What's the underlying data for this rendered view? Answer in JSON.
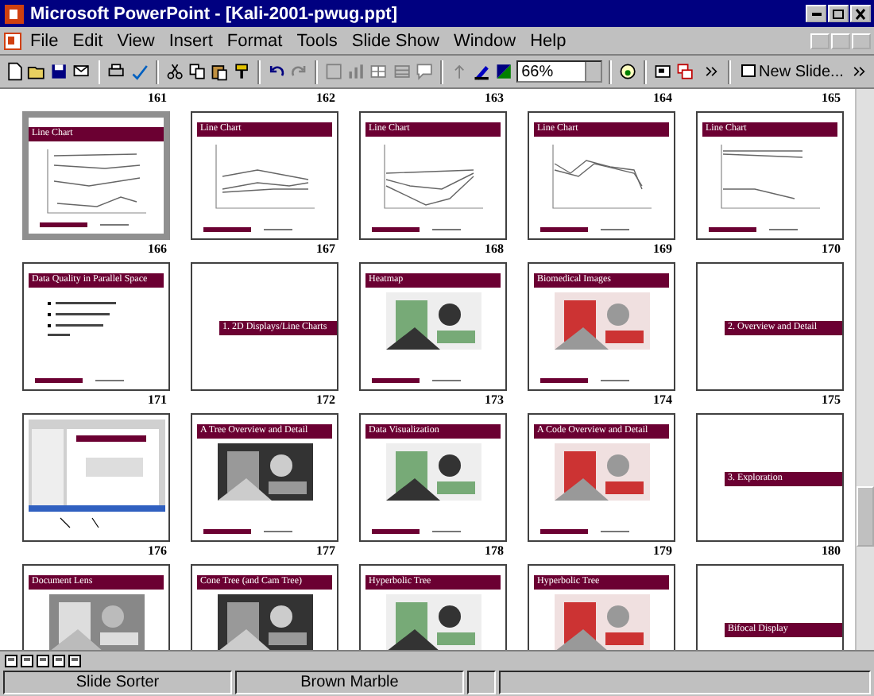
{
  "window": {
    "title": "Microsoft PowerPoint - [Kali-2001-pwug.ppt]"
  },
  "menu": [
    "File",
    "Edit",
    "View",
    "Insert",
    "Format",
    "Tools",
    "Slide Show",
    "Window",
    "Help"
  ],
  "toolbar": {
    "zoom": "66%",
    "new_slide": "New Slide..."
  },
  "numbers_above": [
    "161",
    "162",
    "163",
    "164",
    "165"
  ],
  "rows": [
    {
      "numbers": [
        "166",
        "167",
        "168",
        "169",
        "170"
      ],
      "slides": [
        {
          "title": "Line Chart",
          "kind": "chart",
          "selected": true
        },
        {
          "title": "Line Chart",
          "kind": "chart",
          "selected": false
        },
        {
          "title": "Line Chart",
          "kind": "chart",
          "selected": false
        },
        {
          "title": "Line Chart",
          "kind": "chart",
          "selected": false
        },
        {
          "title": "Line Chart",
          "kind": "chart",
          "selected": false
        }
      ]
    },
    {
      "numbers": [
        "171",
        "172",
        "173",
        "174",
        "175"
      ],
      "slides": [
        {
          "title": "Data Quality in Parallel Space",
          "kind": "bullets",
          "selected": false
        },
        {
          "title": "1. 2D Displays/Line Charts",
          "kind": "section",
          "selected": false
        },
        {
          "title": "Heatmap",
          "selected": false
        },
        {
          "title": "Biomedical Images",
          "selected": false
        },
        {
          "title": "2. Overview and Detail",
          "kind": "section",
          "selected": false
        }
      ]
    },
    {
      "numbers": [
        "176",
        "177",
        "178",
        "179",
        "180"
      ],
      "slides": [
        {
          "kind": "screenshot",
          "selected": false
        },
        {
          "title": "A Tree Overview and Detail",
          "selected": false
        },
        {
          "title": "Data Visualization",
          "selected": false
        },
        {
          "title": "A Code Overview and Detail",
          "selected": false
        },
        {
          "title": "3. Exploration",
          "kind": "section",
          "selected": false
        }
      ]
    },
    {
      "slides": [
        {
          "title": "Document Lens",
          "selected": false
        },
        {
          "title": "Cone Tree (and Cam Tree)",
          "selected": false
        },
        {
          "title": "Hyperbolic Tree",
          "selected": false
        },
        {
          "title": "Hyperbolic Tree",
          "selected": false
        },
        {
          "title": "Bifocal Display",
          "kind": "section",
          "selected": false
        }
      ]
    }
  ],
  "status_bar": [
    "Slide Sorter",
    "Brown Marble"
  ]
}
